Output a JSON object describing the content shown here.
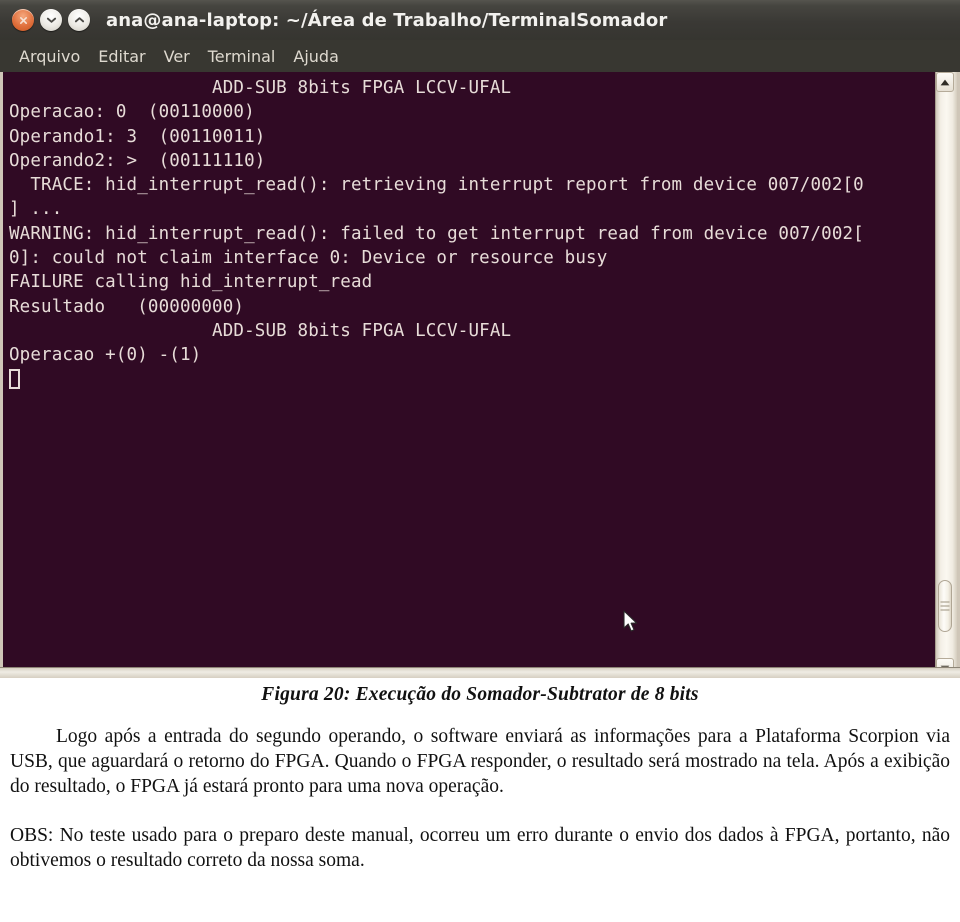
{
  "window": {
    "title": "ana@ana-laptop: ~/Área de Trabalho/TerminalSomador",
    "buttons": {
      "close": "close-window",
      "minimize": "minimize-window",
      "maximize": "maximize-window"
    },
    "menu": [
      {
        "label": "Arquivo"
      },
      {
        "label": "Editar"
      },
      {
        "label": "Ver"
      },
      {
        "label": "Terminal"
      },
      {
        "label": "Ajuda"
      }
    ],
    "colors": {
      "titlebar": "#3c3b37",
      "terminal_bg": "#300a24",
      "terminal_fg": "#e7dcd8",
      "close_button": "#e0703d",
      "scrollbar": "#f3efe6"
    }
  },
  "terminal": {
    "lines": [
      "                   ADD-SUB 8bits FPGA LCCV-UFAL",
      "",
      "Operacao: 0  (00110000)",
      "Operando1: 3  (00110011)",
      "Operando2: >  (00111110)",
      "  TRACE: hid_interrupt_read(): retrieving interrupt report from device 007/002[0",
      "] ...",
      "WARNING: hid_interrupt_read(): failed to get interrupt read from device 007/002[",
      "0]: could not claim interface 0: Device or resource busy",
      "FAILURE calling hid_interrupt_read",
      "",
      "Resultado   (00000000)",
      "                   ADD-SUB 8bits FPGA LCCV-UFAL",
      "",
      "Operacao +(0) -(1)"
    ],
    "cursor": "block-cursor"
  },
  "document": {
    "figure_caption": "Figura 20: Execução do Somador-Subtrator de 8 bits",
    "paragraph_1": "Logo após a entrada do segundo operando, o software enviará as informações para a Plataforma Scorpion via USB, que aguardará o retorno do FPGA. Quando o FPGA responder, o resultado será mostrado na tela. Após a exibição do resultado, o FPGA já estará pronto para uma nova operação.",
    "paragraph_2": "OBS: No teste usado para o preparo deste manual, ocorreu um erro durante o envio dos dados à FPGA, portanto, não obtivemos o resultado correto da nossa soma."
  }
}
